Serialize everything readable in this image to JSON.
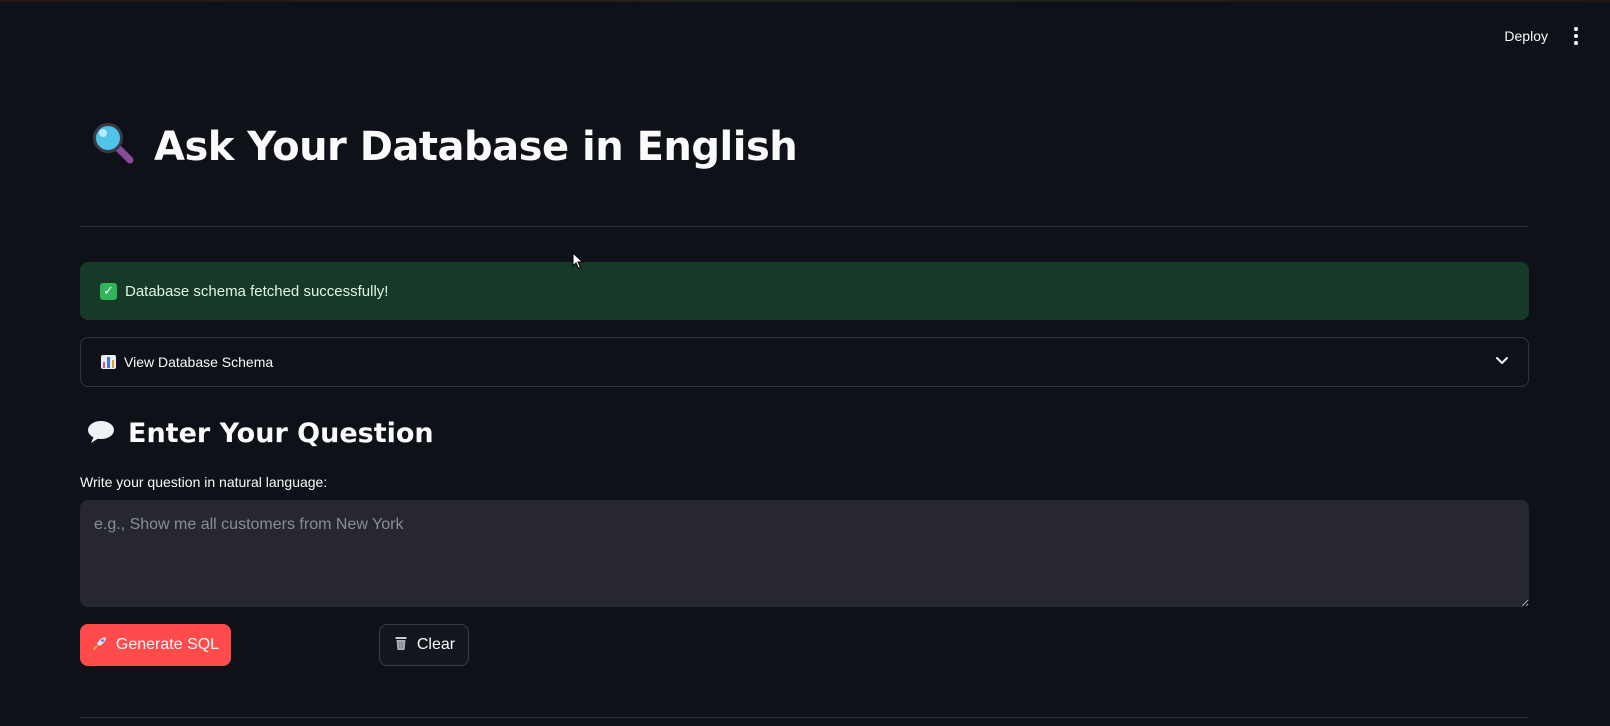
{
  "header": {
    "deploy_label": "Deploy",
    "menu_icon": "vertical-ellipsis-icon"
  },
  "main": {
    "title": "Ask Your Database in English",
    "title_icon": "magnifying-glass-icon",
    "alert": {
      "text": "Database schema fetched successfully!",
      "icon": "check-mark-icon",
      "status_color": "#173928"
    },
    "expander": {
      "label": "View Database Schema",
      "icon": "bar-chart-icon",
      "chevron_icon": "chevron-down-icon"
    },
    "question": {
      "heading": "Enter Your Question",
      "heading_icon": "speech-bubble-icon",
      "input_label": "Write your question in natural language:",
      "value": "",
      "placeholder": "e.g., Show me all customers from New York"
    },
    "buttons": {
      "generate_label": "Generate SQL",
      "generate_icon": "rocket-icon",
      "clear_label": "Clear",
      "clear_icon": "wastebasket-icon"
    }
  },
  "colors": {
    "background": "#0e1117",
    "accent": "#ff4b4b",
    "success_bg": "#173928",
    "input_bg": "#262730"
  }
}
